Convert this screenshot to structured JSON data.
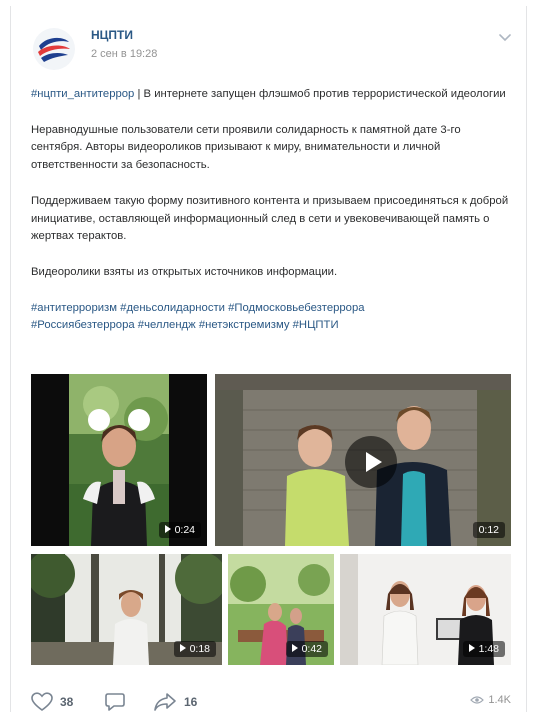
{
  "post": {
    "author": "НЦПТИ",
    "date": "2 сен в 19:28",
    "paragraphs": {
      "intro_tag": "#нцпти_антитеррор",
      "intro_text": " | В интернете запущен флэшмоб против террористической идеологии",
      "p2": "Неравнодушные пользователи сети проявили солидарность к памятной дате 3-го сентября. Авторы видеороликов призывают к миру, внимательности и личной ответственности за безопасность.",
      "p3": "Поддерживаем такую форму позитивного контента и призываем присоединяться к доброй инициативе, оставляющей информационный след в сети и увековечивающей память о жертвах терактов.",
      "p4": "Видеоролики взяты из открытых источников информации."
    },
    "hashtags": [
      "#антитерроризм",
      "#деньсолидарности",
      "#Подмосковьебезтеррора",
      "#Россиябезтеррора",
      "#челлендж",
      "#нетэкстремизму",
      "#НЦПТИ"
    ],
    "videos": [
      {
        "duration": "0:24",
        "icon": "play-icon"
      },
      {
        "duration": "0:12",
        "icon": "play-icon"
      },
      {
        "duration": "0:18",
        "icon": "play-icon"
      },
      {
        "duration": "0:42",
        "icon": "play-icon"
      },
      {
        "duration": "1:48",
        "icon": "play-icon"
      }
    ],
    "actions": {
      "likes": "38",
      "shares": "16",
      "views": "1.4K"
    }
  },
  "colors": {
    "link": "#2a5885",
    "text": "#2c2d2e",
    "meta": "#939393"
  }
}
